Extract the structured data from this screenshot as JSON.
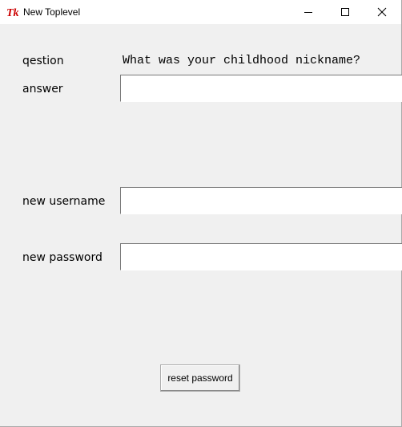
{
  "window": {
    "title": "New Toplevel",
    "icon": "tk-feather-icon"
  },
  "form": {
    "question_label": "qestion",
    "question_value": "What was your childhood nickname?",
    "answer_label": "answer",
    "answer_value": "",
    "new_username_label": "new username",
    "new_username_value": "",
    "new_password_label": "new password",
    "new_password_value": "",
    "reset_button_label": "reset password"
  },
  "colors": {
    "background": "#f0f0f0",
    "titlebar": "#ffffff",
    "entry_background": "#ffffff",
    "logo_red": "#cc0000"
  }
}
